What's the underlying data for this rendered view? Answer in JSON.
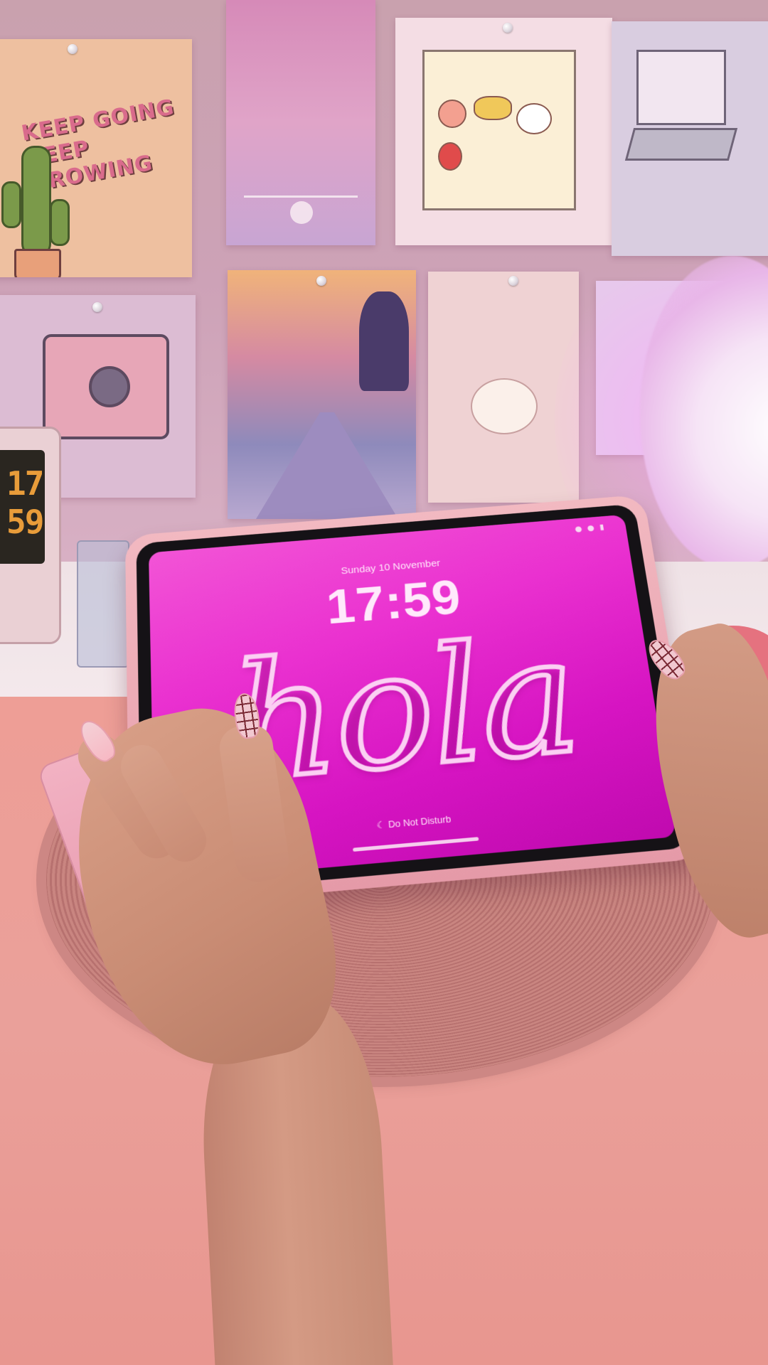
{
  "wall_art": {
    "cactus_poster": {
      "line1": "KEEP GOING",
      "line2": "KEEP GROWING"
    }
  },
  "speaker": {
    "display_digits": "17 59"
  },
  "tablet": {
    "lock_screen": {
      "date": "Sunday 10 November",
      "time": "17:59",
      "wallpaper_text": "hola",
      "focus_label": "Do Not Disturb",
      "focus_icon": "moon-icon",
      "background_color": "#e52ccd"
    }
  }
}
